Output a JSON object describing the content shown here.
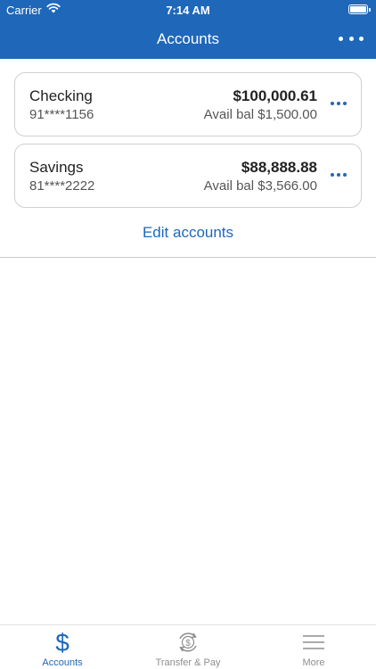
{
  "status_bar": {
    "carrier": "Carrier",
    "time": "7:14 AM"
  },
  "nav": {
    "title": "Accounts"
  },
  "accounts": [
    {
      "name": "Checking",
      "number": "91****1156",
      "balance": "$100,000.61",
      "available": "Avail bal $1,500.00"
    },
    {
      "name": "Savings",
      "number": "81****2222",
      "balance": "$88,888.88",
      "available": "Avail bal $3,566.00"
    }
  ],
  "edit_accounts_label": "Edit accounts",
  "tabs": [
    {
      "label": "Accounts",
      "icon": "dollar-icon",
      "active": true
    },
    {
      "label": "Transfer & Pay",
      "icon": "transfer-pay-icon",
      "active": false
    },
    {
      "label": "More",
      "icon": "menu-icon",
      "active": false
    }
  ],
  "colors": {
    "brand_blue": "#1f67b9",
    "card_border": "#cfcfcf",
    "inactive_tab": "#8e8e8e"
  }
}
